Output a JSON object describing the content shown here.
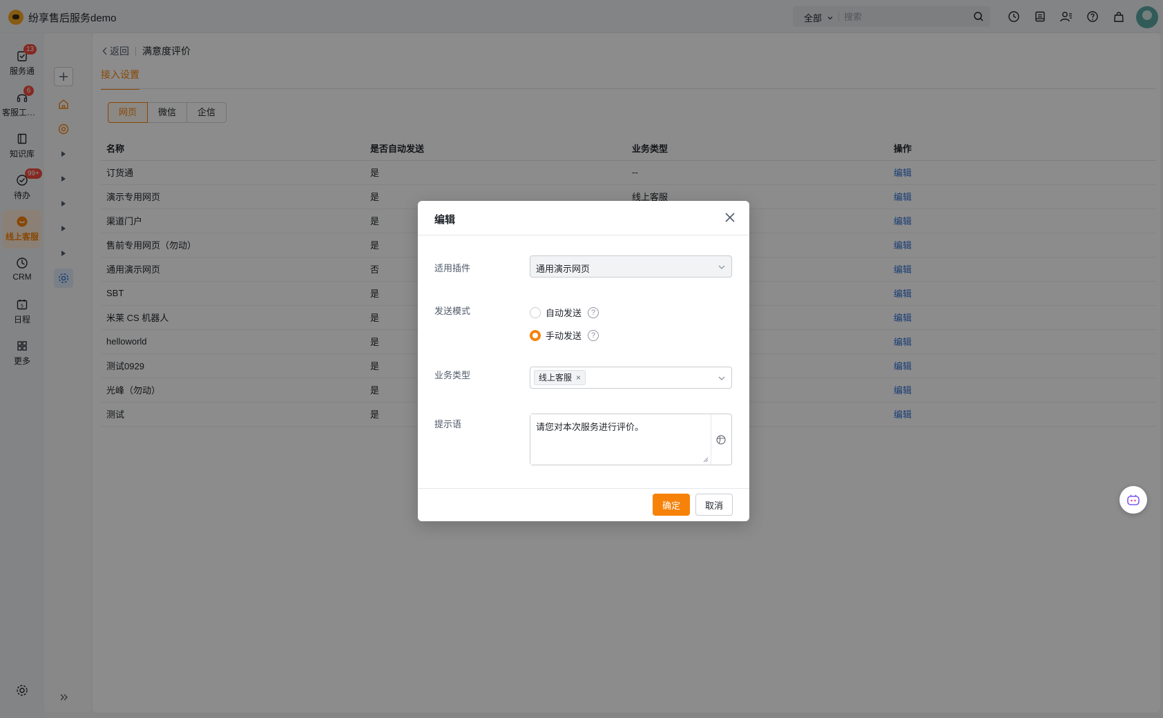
{
  "app": {
    "title": "纷享售后服务demo"
  },
  "search": {
    "scope": "全部",
    "placeholder": "搜索"
  },
  "topbar_icons": [
    "clock-icon",
    "inbox-icon",
    "contacts-icon",
    "help-icon",
    "bag-icon"
  ],
  "nav": [
    {
      "label": "服务通",
      "badge": "13",
      "icon": "service-icon"
    },
    {
      "label": "客服工作台",
      "badge": "6",
      "icon": "headset-icon"
    },
    {
      "label": "知识库",
      "badge": "",
      "icon": "book-icon"
    },
    {
      "label": "待办",
      "badge": "99+",
      "icon": "todo-icon"
    },
    {
      "label": "线上客服",
      "badge": "",
      "icon": "chat-icon",
      "active": true
    },
    {
      "label": "CRM",
      "badge": "",
      "icon": "crm-icon"
    },
    {
      "label": "日程",
      "badge": "",
      "icon": "calendar-icon"
    },
    {
      "label": "更多",
      "badge": "",
      "icon": "grid-icon"
    }
  ],
  "breadcrumb": {
    "back": "返回",
    "current": "满意度评价"
  },
  "tab": {
    "label": "接入设置"
  },
  "segments": [
    "网页",
    "微信",
    "企信"
  ],
  "table": {
    "headers": [
      "名称",
      "是否自动发送",
      "业务类型",
      "操作"
    ],
    "rows": [
      [
        "订货通",
        "是",
        "--",
        "编辑"
      ],
      [
        "演示专用网页",
        "是",
        "线上客服",
        "编辑"
      ],
      [
        "渠道门户",
        "是",
        "",
        "编辑"
      ],
      [
        "售前专用网页（勿动）",
        "是",
        "",
        "编辑"
      ],
      [
        "通用演示网页",
        "否",
        "",
        "编辑"
      ],
      [
        "SBT",
        "是",
        "",
        "编辑"
      ],
      [
        "米莱 CS 机器人",
        "是",
        "",
        "编辑"
      ],
      [
        "helloworld",
        "是",
        "",
        "编辑"
      ],
      [
        "测试0929",
        "是",
        "",
        "编辑"
      ],
      [
        "光峰（勿动）",
        "是",
        "",
        "编辑"
      ],
      [
        "测试",
        "是",
        "",
        "编辑"
      ]
    ]
  },
  "dialog": {
    "title": "编辑",
    "plugin_label": "适用插件",
    "plugin_value": "通用演示网页",
    "mode_label": "发送模式",
    "mode_auto": "自动发送",
    "mode_manual": "手动发送",
    "selected_mode": "手动发送",
    "biz_label": "业务类型",
    "biz_tag": "线上客服",
    "tip_label": "提示语",
    "tip_value": "请您对本次服务进行评价。",
    "ok": "确定",
    "cancel": "取消"
  },
  "colors": {
    "accent": "#f7820a",
    "link": "#2f6fd6",
    "badge": "#f04b3e"
  }
}
